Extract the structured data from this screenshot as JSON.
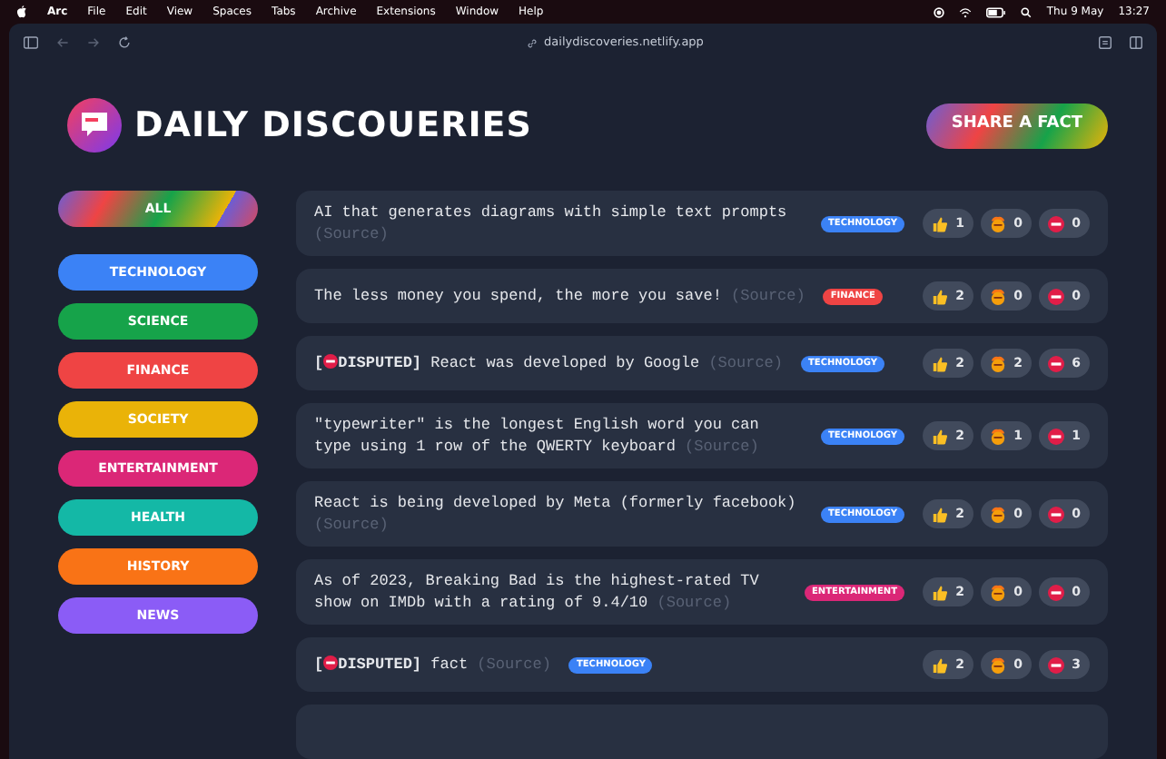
{
  "menu_bar": {
    "app": "Arc",
    "items": [
      "File",
      "Edit",
      "View",
      "Spaces",
      "Tabs",
      "Archive",
      "Extensions",
      "Window",
      "Help"
    ],
    "date": "Thu 9 May",
    "time": "13:27"
  },
  "browser": {
    "url": "dailydiscoveries.netlify.app"
  },
  "header": {
    "title": "DAILY DISCOUERIES",
    "share_button": "SHARE A FACT"
  },
  "categories": [
    {
      "label": "ALL",
      "kind": "rainbow"
    },
    {
      "label": "TECHNOLOGY",
      "kind": "solid",
      "color": "#3b82f6"
    },
    {
      "label": "SCIENCE",
      "kind": "solid",
      "color": "#16a34a"
    },
    {
      "label": "FINANCE",
      "kind": "solid",
      "color": "#ef4444"
    },
    {
      "label": "SOCIETY",
      "kind": "solid",
      "color": "#eab308"
    },
    {
      "label": "ENTERTAINMENT",
      "kind": "solid",
      "color": "#db2777"
    },
    {
      "label": "HEALTH",
      "kind": "solid",
      "color": "#14b8a6"
    },
    {
      "label": "HISTORY",
      "kind": "solid",
      "color": "#f97316"
    },
    {
      "label": "NEWS",
      "kind": "solid",
      "color": "#8b5cf6"
    }
  ],
  "facts": [
    {
      "disputed": false,
      "text": "AI that generates diagrams with simple text prompts",
      "source": "(Source)",
      "tag": {
        "label": "TECHNOLOGY",
        "color": "#3b82f6"
      },
      "votes": [
        {
          "kind": "like",
          "count": "1"
        },
        {
          "kind": "mindblown",
          "count": "0"
        },
        {
          "kind": "false",
          "count": "0"
        }
      ]
    },
    {
      "disputed": false,
      "text": "The less money you spend, the more you save!",
      "source": "(Source)",
      "tag": {
        "label": "FINANCE",
        "color": "#ef4444"
      },
      "votes": [
        {
          "kind": "like",
          "count": "2"
        },
        {
          "kind": "mindblown",
          "count": "0"
        },
        {
          "kind": "false",
          "count": "0"
        }
      ]
    },
    {
      "disputed": true,
      "disputed_open": "[",
      "disputed_label": "DISPUTED]",
      "text": "React was developed by Google",
      "source": "(Source)",
      "tag": {
        "label": "TECHNOLOGY",
        "color": "#3b82f6"
      },
      "votes": [
        {
          "kind": "like",
          "count": "2"
        },
        {
          "kind": "mindblown",
          "count": "2"
        },
        {
          "kind": "false",
          "count": "6"
        }
      ]
    },
    {
      "disputed": false,
      "text": "\"typewriter\" is the longest English word you can type using 1 row of the QWERTY keyboard",
      "source": "(Source)",
      "tag": {
        "label": "TECHNOLOGY",
        "color": "#3b82f6"
      },
      "votes": [
        {
          "kind": "like",
          "count": "2"
        },
        {
          "kind": "mindblown",
          "count": "1"
        },
        {
          "kind": "false",
          "count": "1"
        }
      ]
    },
    {
      "disputed": false,
      "text": "React is being developed by Meta (formerly facebook)",
      "source": "(Source)",
      "tag": {
        "label": "TECHNOLOGY",
        "color": "#3b82f6"
      },
      "votes": [
        {
          "kind": "like",
          "count": "2"
        },
        {
          "kind": "mindblown",
          "count": "0"
        },
        {
          "kind": "false",
          "count": "0"
        }
      ]
    },
    {
      "disputed": false,
      "text": "As of 2023, Breaking Bad is the highest-rated TV show on IMDb with a rating of 9.4/10",
      "source": "(Source)",
      "tag": {
        "label": "ENTERTAINMENT",
        "color": "#db2777"
      },
      "votes": [
        {
          "kind": "like",
          "count": "2"
        },
        {
          "kind": "mindblown",
          "count": "0"
        },
        {
          "kind": "false",
          "count": "0"
        }
      ]
    },
    {
      "disputed": true,
      "disputed_open": "[",
      "disputed_label": "DISPUTED]",
      "text": "fact",
      "source": "(Source)",
      "tag": {
        "label": "TECHNOLOGY",
        "color": "#3b82f6"
      },
      "votes": [
        {
          "kind": "like",
          "count": "2"
        },
        {
          "kind": "mindblown",
          "count": "0"
        },
        {
          "kind": "false",
          "count": "3"
        }
      ]
    }
  ]
}
